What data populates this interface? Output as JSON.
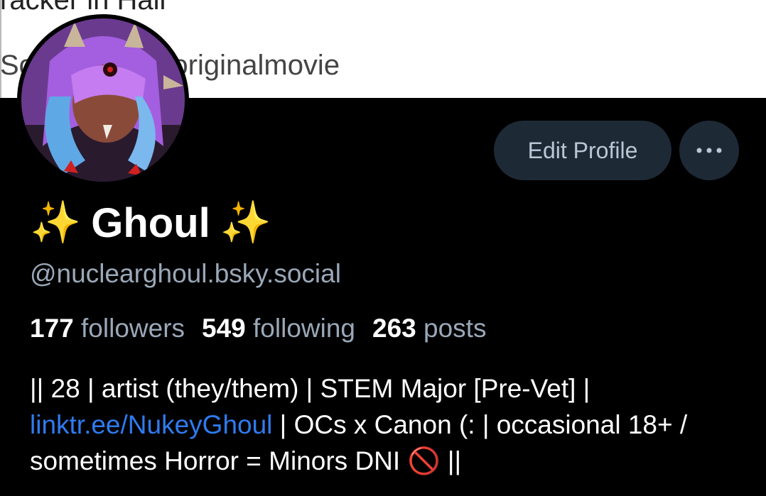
{
  "banner": {
    "line1": "racker in Hall",
    "line2": "So                    eychanneloriginalmovie"
  },
  "profile": {
    "avatar_alt": "profile avatar",
    "name_prefix_emoji": "✨",
    "name": "Ghoul",
    "name_suffix_emoji": "✨",
    "handle": "@nuclearghoul.bsky.social",
    "edit_profile_label": "Edit Profile",
    "more_label": "•••"
  },
  "stats": {
    "followers_count": "177",
    "followers_label": "followers",
    "following_count": "549",
    "following_label": "following",
    "posts_count": "263",
    "posts_label": "posts"
  },
  "bio": {
    "part1": "|| 28 | artist (they/them) | STEM Major [Pre-Vet] |",
    "link": "linktr.ee/NukeyGhoul",
    "part2": " | OCs x Canon (: | occasional 18+ / sometimes Horror = Minors DNI ",
    "emoji": "🚫",
    "part3": " ||"
  },
  "colors": {
    "background": "#000000",
    "button_bg": "#1e2936",
    "muted_text": "#9aa8b8",
    "link": "#2f7bf0"
  }
}
